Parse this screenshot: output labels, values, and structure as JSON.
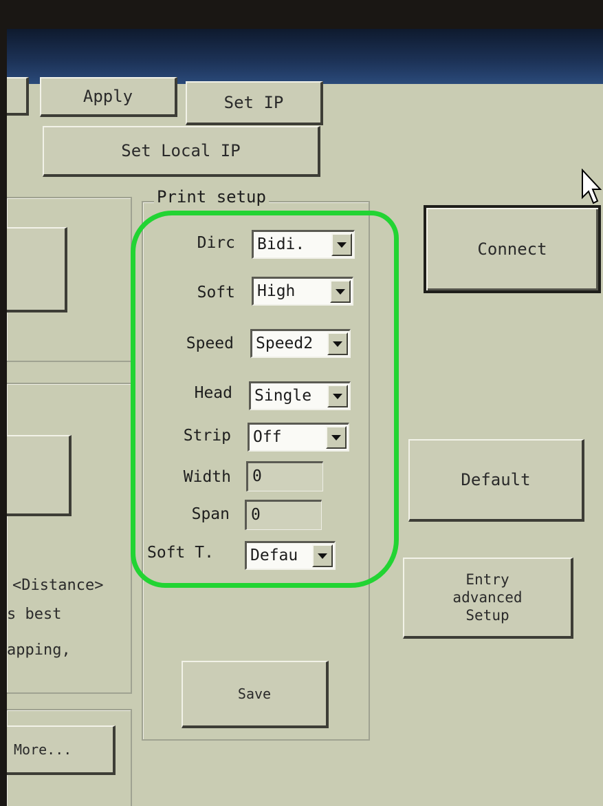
{
  "toolbar": {
    "apply_label": "Apply",
    "set_ip_label": "Set IP",
    "set_local_ip_label": "Set Local IP"
  },
  "print_setup": {
    "title": "Print setup",
    "fields": {
      "dirc": {
        "label": "Dirc",
        "value": "Bidi."
      },
      "soft": {
        "label": "Soft",
        "value": "High"
      },
      "speed": {
        "label": "Speed",
        "value": "Speed2"
      },
      "head": {
        "label": "Head",
        "value": "Single"
      },
      "strip": {
        "label": "Strip",
        "value": "Off"
      },
      "width": {
        "label": "Width",
        "value": "0"
      },
      "span": {
        "label": "Span",
        "value": "0"
      },
      "soft_t": {
        "label": "Soft T.",
        "value": "Defau"
      }
    },
    "save_label": "Save"
  },
  "right_panel": {
    "connect_label": "Connect",
    "default_label": "Default",
    "entry_advanced_lines": [
      "Entry",
      "advanced",
      "Setup"
    ]
  },
  "left_panel": {
    "distance_text": "<Distance>",
    "best_text": "s best",
    "apping_text": "apping,",
    "more_label": "More..."
  },
  "colors": {
    "window_bg": "#c9ccb3",
    "titlebar": "#1d3358",
    "highlight_annotation": "#22d433"
  },
  "icons": {
    "dropdown": "chevron-down-icon",
    "cursor": "mouse-pointer-icon"
  }
}
